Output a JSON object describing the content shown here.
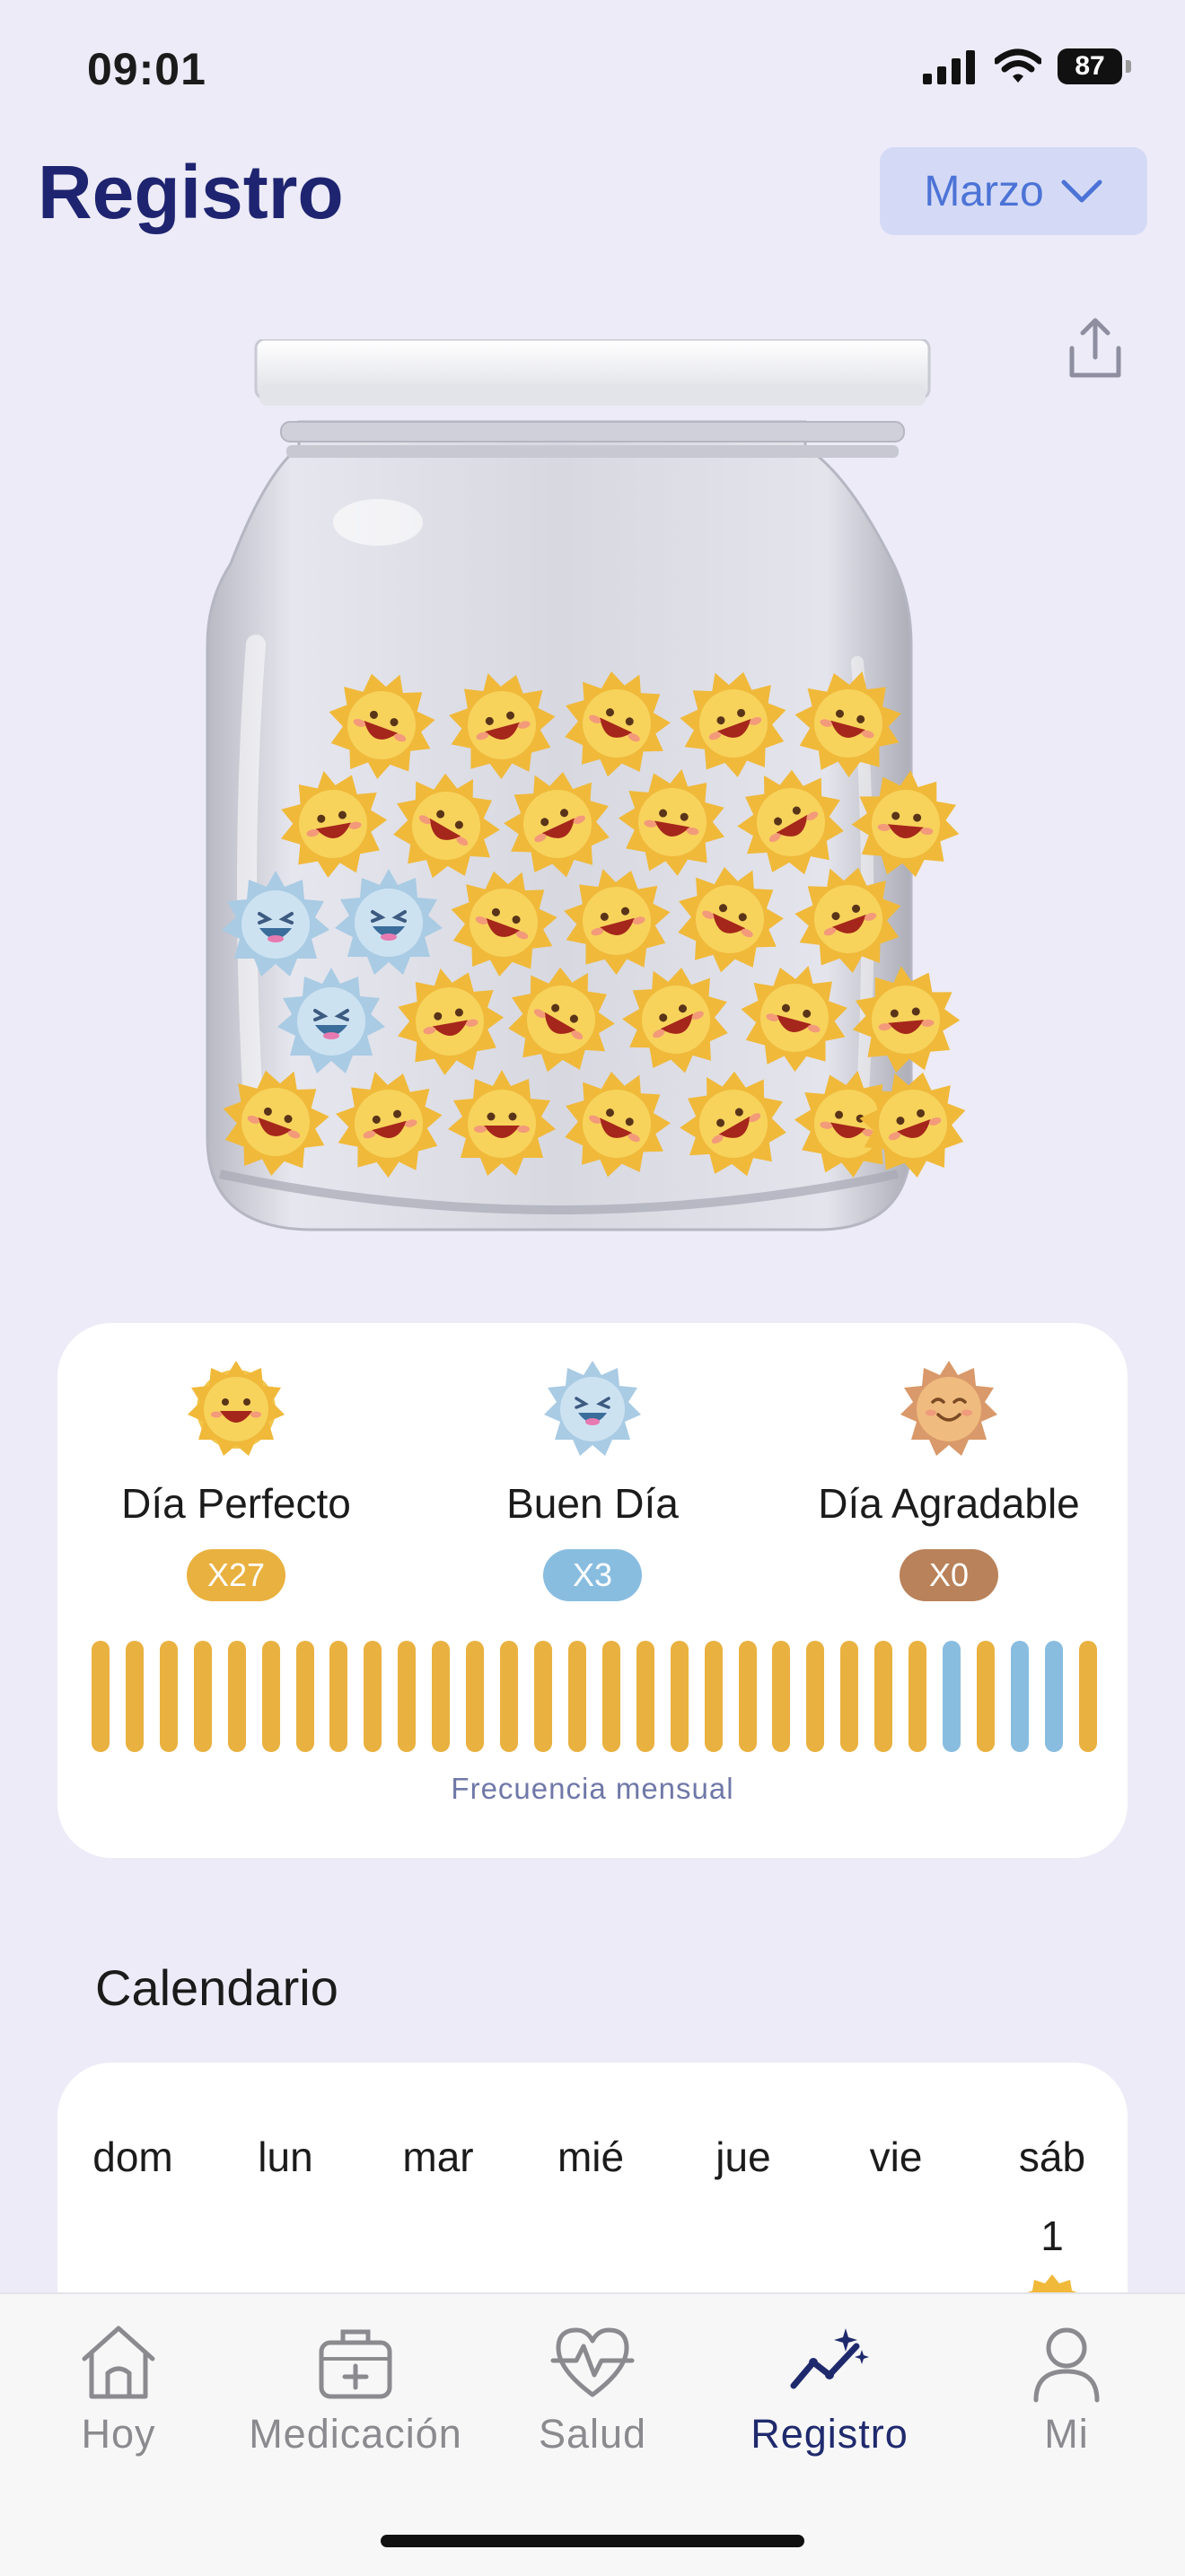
{
  "status_bar": {
    "time": "09:01",
    "battery": "87"
  },
  "header": {
    "title": "Registro",
    "month": "Marzo"
  },
  "jar": {
    "perfect_count": 27,
    "good_count": 3
  },
  "summary": {
    "categories": [
      {
        "label": "Día Perfecto",
        "badge": "X27",
        "color": "#e9b13f",
        "icon": "sun-grin-icon"
      },
      {
        "label": "Buen Día",
        "badge": "X3",
        "color": "#89bde0",
        "icon": "sun-laugh-icon"
      },
      {
        "label": "Día Agradable",
        "badge": "X0",
        "color": "#b9825a",
        "icon": "sun-smile-icon"
      }
    ],
    "frequency_label": "Frecuencia mensual",
    "frequency_days": [
      "perfect",
      "perfect",
      "perfect",
      "perfect",
      "perfect",
      "perfect",
      "perfect",
      "perfect",
      "perfect",
      "perfect",
      "perfect",
      "perfect",
      "perfect",
      "perfect",
      "perfect",
      "perfect",
      "perfect",
      "perfect",
      "perfect",
      "perfect",
      "perfect",
      "perfect",
      "perfect",
      "perfect",
      "perfect",
      "good",
      "perfect",
      "good",
      "good",
      "perfect"
    ]
  },
  "calendar": {
    "title": "Calendario",
    "weekdays": [
      "dom",
      "lun",
      "mar",
      "mié",
      "jue",
      "vie",
      "sáb"
    ],
    "first_day": "1"
  },
  "tabbar": {
    "tabs": [
      {
        "label": "Hoy",
        "icon": "house-icon"
      },
      {
        "label": "Medicación",
        "icon": "medkit-icon"
      },
      {
        "label": "Salud",
        "icon": "heart-pulse-icon"
      },
      {
        "label": "Registro",
        "icon": "trend-sparkle-icon",
        "active": true
      },
      {
        "label": "Mi",
        "icon": "person-icon"
      }
    ]
  }
}
